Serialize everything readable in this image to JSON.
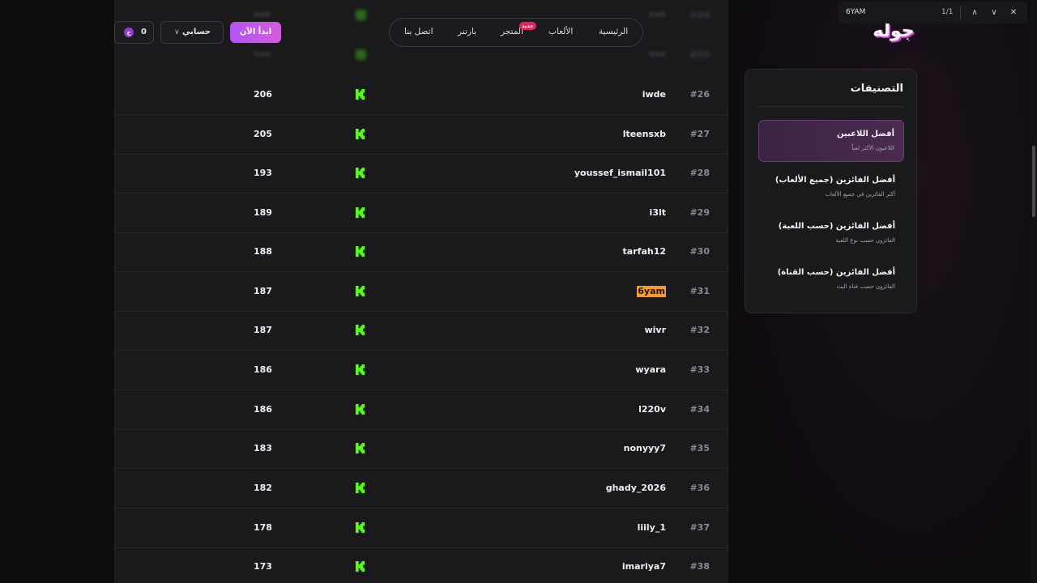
{
  "brand": {
    "logo_text": "جوله"
  },
  "nav": {
    "items": [
      {
        "label": "الرئيسية"
      },
      {
        "label": "الألعاب"
      },
      {
        "label": "المتجر",
        "badge": "جديد"
      },
      {
        "label": "بارتنر"
      },
      {
        "label": "اتصل بنا"
      }
    ]
  },
  "header": {
    "start_button": "ابدأ الآن",
    "account_button": "حسابي",
    "coins_value": "0",
    "coin_symbol": "ج"
  },
  "find_bar": {
    "query": "6YAM",
    "count": "1/1"
  },
  "sidebar": {
    "title": "التصنيفات",
    "categories": [
      {
        "title": "أفضل اللاعبين",
        "subtitle": "اللاعبون الأكثر لعباً",
        "active": true
      },
      {
        "title": "أفضل الفائزين (جميع الألعاب)",
        "subtitle": "أكثر الفائزين في جميع الألعاب",
        "active": false
      },
      {
        "title": "أفضل الفائزين (حسب اللعبة)",
        "subtitle": "الفائزون حسب نوع اللعبة",
        "active": false
      },
      {
        "title": "أفضل الفائزين (حسب القناة)",
        "subtitle": "الفائزون حسب قناة البث",
        "active": false
      }
    ]
  },
  "leaderboard": {
    "platform_icon": "kick-logo-icon",
    "accent_color": "#53fc18",
    "rows": [
      {
        "rank": "#24",
        "username": "•••",
        "score": "•••"
      },
      {
        "rank": "#25",
        "username": "•••",
        "score": "•••"
      },
      {
        "rank": "#26",
        "username": "iwde",
        "score": "206"
      },
      {
        "rank": "#27",
        "username": "lteensxb",
        "score": "205"
      },
      {
        "rank": "#28",
        "username": "youssef_ismail101",
        "score": "193"
      },
      {
        "rank": "#29",
        "username": "i3lt",
        "score": "189"
      },
      {
        "rank": "#30",
        "username": "tarfah12",
        "score": "188"
      },
      {
        "rank": "#31",
        "username": "6yam",
        "score": "187",
        "highlighted": true
      },
      {
        "rank": "#32",
        "username": "wivr",
        "score": "187"
      },
      {
        "rank": "#33",
        "username": "wyara",
        "score": "186"
      },
      {
        "rank": "#34",
        "username": "l220v",
        "score": "186"
      },
      {
        "rank": "#35",
        "username": "nonyyy7",
        "score": "183"
      },
      {
        "rank": "#36",
        "username": "ghady_2026",
        "score": "182"
      },
      {
        "rank": "#37",
        "username": "liily_1",
        "score": "178"
      },
      {
        "rank": "#38",
        "username": "imariya7",
        "score": "173"
      }
    ]
  }
}
